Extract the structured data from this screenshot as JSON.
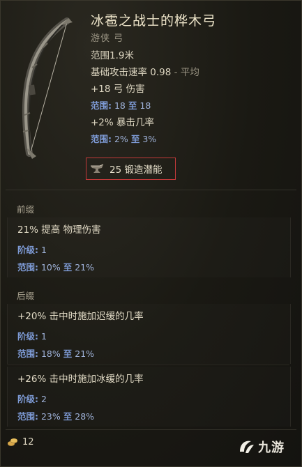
{
  "item": {
    "title": "冰雹之战士的桦木弓",
    "subtitle": "游侠 弓",
    "icon": "bow-icon"
  },
  "stats": [
    {
      "type": "plain",
      "text": "范围1.9米"
    },
    {
      "type": "plain",
      "main": "基础攻击速率 0.98",
      "suffix": " - 平均"
    },
    {
      "type": "plain",
      "text": "+18 弓 伤害"
    },
    {
      "type": "range",
      "label": "范围:",
      "from": "18",
      "to_word": "至",
      "to": "18"
    },
    {
      "type": "plain",
      "text": "+2% 暴击几率"
    },
    {
      "type": "range",
      "label": "范围:",
      "from": "2%",
      "to_word": "至",
      "to": "3%"
    }
  ],
  "forge": {
    "icon": "anvil-icon",
    "text": "25 锻造潜能"
  },
  "prefix_section": {
    "label": "前缀",
    "affixes": [
      {
        "title": "21% 提高 物理伤害",
        "tier_label": "阶级:",
        "tier": "1",
        "range_label": "范围:",
        "range_from": "10%",
        "to_word": "至",
        "range_to": "21%"
      }
    ]
  },
  "suffix_section": {
    "label": "后缀",
    "affixes": [
      {
        "title": "+20% 击中时施加迟缓的几率",
        "tier_label": "阶级:",
        "tier": "1",
        "range_label": "范围:",
        "range_from": "18%",
        "to_word": "至",
        "range_to": "21%"
      },
      {
        "title": "+26% 击中时施加冰缓的几率",
        "tier_label": "阶级:",
        "tier": "2",
        "range_label": "范围:",
        "range_from": "23%",
        "to_word": "至",
        "range_to": "28%"
      }
    ]
  },
  "footer": {
    "icon": "coin-icon",
    "count": "12"
  },
  "watermark": {
    "icon": "jiuyou-logo-icon",
    "text": "九游"
  },
  "colors": {
    "background": "#15140f",
    "title": "#ece3c8",
    "range_text": "#9fb2d9",
    "range_keyword": "#7e9bd6",
    "highlight_border": "#c43a3a"
  }
}
